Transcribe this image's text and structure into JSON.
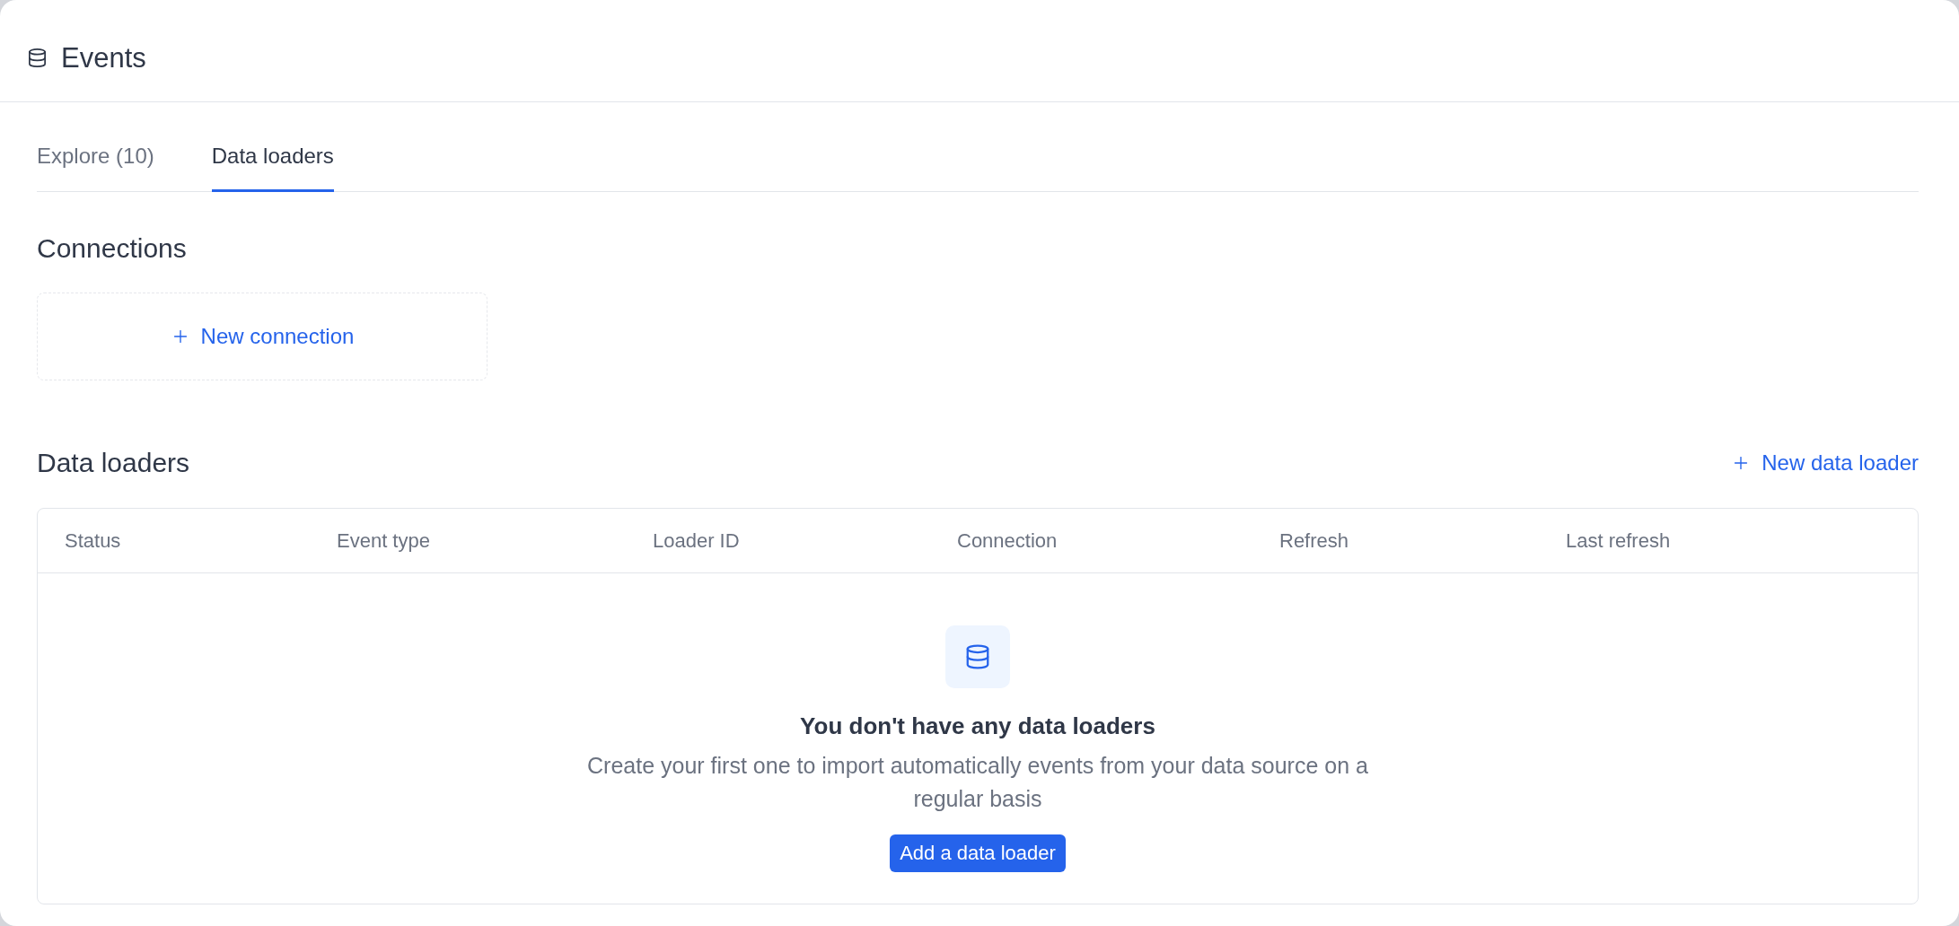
{
  "header": {
    "title": "Events"
  },
  "tabs": [
    {
      "label": "Explore (10)",
      "selected": false
    },
    {
      "label": "Data loaders",
      "selected": true
    }
  ],
  "connections": {
    "heading": "Connections",
    "new_button": "New connection"
  },
  "data_loaders": {
    "heading": "Data loaders",
    "new_button": "New data loader",
    "table": {
      "columns": [
        "Status",
        "Event type",
        "Loader ID",
        "Connection",
        "Refresh",
        "Last refresh"
      ]
    },
    "empty_state": {
      "title": "You don't have any data loaders",
      "description": "Create your first one to import automatically events from your data source on a regular basis",
      "button": "Add a data loader"
    }
  }
}
